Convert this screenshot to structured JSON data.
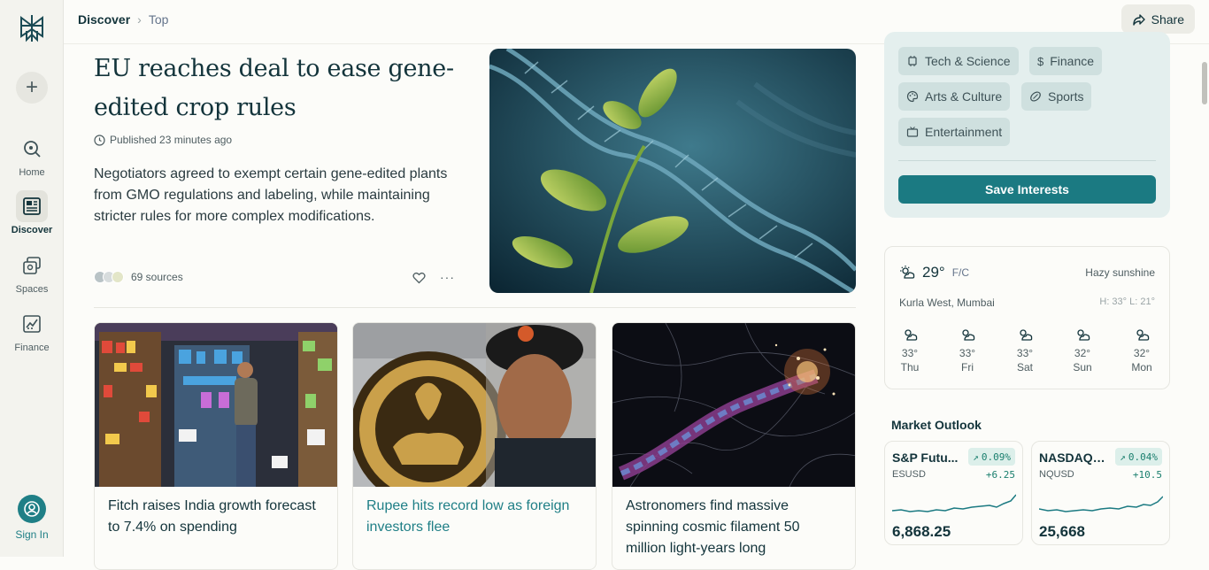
{
  "sidebar": {
    "items": [
      {
        "label": "Home",
        "icon": "search-icon"
      },
      {
        "label": "Discover",
        "icon": "newspaper-icon"
      },
      {
        "label": "Spaces",
        "icon": "spaces-icon"
      },
      {
        "label": "Finance",
        "icon": "chart-icon"
      }
    ],
    "sign_in": "Sign In"
  },
  "breadcrumb": {
    "root": "Discover",
    "current": "Top"
  },
  "share_label": "Share",
  "hero": {
    "title": "EU reaches deal to ease gene-edited crop rules",
    "published": "Published 23 minutes ago",
    "summary": "Negotiators agreed to exempt certain gene-edited plants from GMO regulations and labeling, while maintaining stricter rules for more complex modifications.",
    "sources": "69 sources"
  },
  "cards": [
    {
      "title": "Fitch raises India growth forecast to 7.4% on spending"
    },
    {
      "title": "Rupee hits record low as foreign investors flee"
    },
    {
      "title": "Astronomers find massive spinning cosmic filament 50 million light-years long"
    }
  ],
  "interests": {
    "chips": [
      {
        "label": "Tech & Science",
        "icon": "chip-icon"
      },
      {
        "label": "Finance",
        "icon": "dollar-icon"
      },
      {
        "label": "Arts & Culture",
        "icon": "palette-icon"
      },
      {
        "label": "Sports",
        "icon": "ball-icon"
      },
      {
        "label": "Entertainment",
        "icon": "tv-icon"
      }
    ],
    "save_label": "Save Interests"
  },
  "weather": {
    "temp": "29°",
    "unit": "F/C",
    "description": "Hazy sunshine",
    "location": "Kurla West, Mumbai",
    "high_low": "H: 33° L: 21°",
    "forecast": [
      {
        "temp": "33°",
        "day": "Thu"
      },
      {
        "temp": "33°",
        "day": "Fri"
      },
      {
        "temp": "33°",
        "day": "Sat"
      },
      {
        "temp": "32°",
        "day": "Sun"
      },
      {
        "temp": "32°",
        "day": "Mon"
      }
    ]
  },
  "market": {
    "title": "Market Outlook",
    "items": [
      {
        "name": "S&P Futu...",
        "change": "0.09%",
        "ticker": "ESUSD",
        "delta": "+6.25",
        "price": "6,868.25"
      },
      {
        "name": "NASDAQ ...",
        "change": "0.04%",
        "ticker": "NQUSD",
        "delta": "+10.5",
        "price": "25,668"
      }
    ]
  },
  "colors": {
    "accent": "#1b7a82",
    "positive": "#1a7f6e",
    "panel": "#e4efee"
  }
}
